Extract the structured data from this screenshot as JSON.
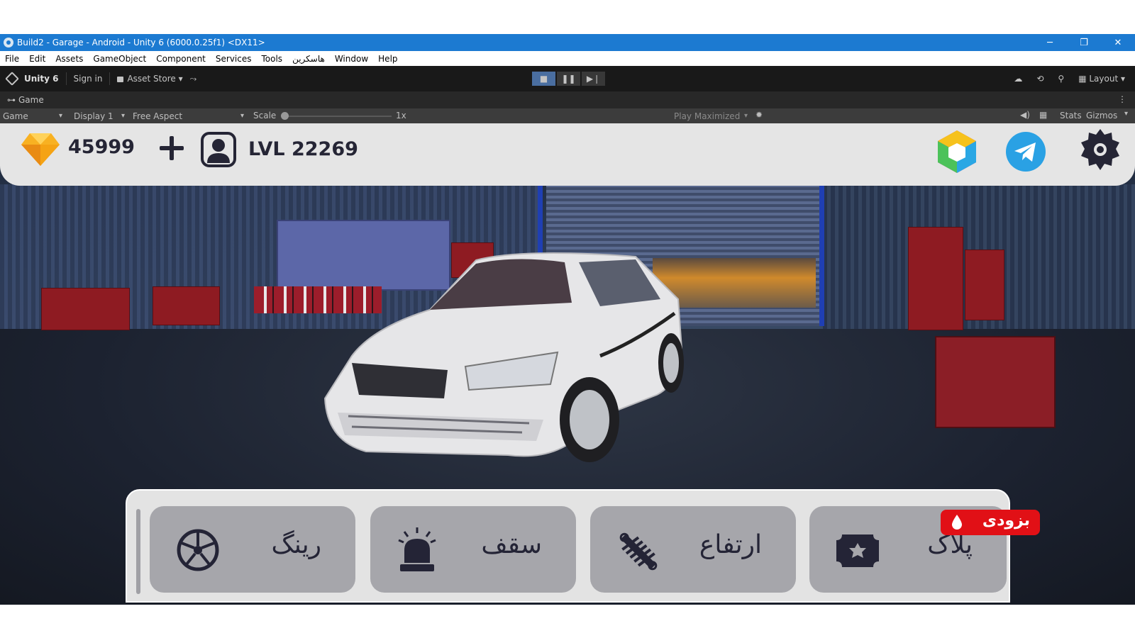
{
  "window": {
    "title": "Build2 - Garage - Android - Unity 6 (6000.0.25f1) <DX11>",
    "controls": [
      "─",
      "❐",
      "✕"
    ]
  },
  "menu": {
    "items": [
      "File",
      "Edit",
      "Assets",
      "GameObject",
      "Component",
      "Services",
      "Tools",
      "هاسکرین",
      "Window",
      "Help"
    ]
  },
  "toolbar": {
    "product": "Unity 6",
    "signin": "Sign in",
    "asset_store": "Asset Store",
    "layout": "Layout",
    "play_buttons": [
      "■",
      "❚❚",
      "▶❘"
    ]
  },
  "game_tab": {
    "label": "Game",
    "kebab": "⋮"
  },
  "game_bar": {
    "mode": "Game",
    "display": "Display 1",
    "aspect": "Free Aspect",
    "scale_label": "Scale",
    "scale_value": "1x",
    "play_maximized": "Play Maximized",
    "stats": "Stats",
    "gizmos": "Gizmos"
  },
  "hud": {
    "gems": "45999",
    "level": "LVL 22269"
  },
  "bottom_menu": {
    "cards": [
      "رینگ",
      "سقف",
      "ارتفاع",
      "پلاک"
    ],
    "soon_badge": "بزودی"
  },
  "colors": {
    "title_bar": "#1c7ad1",
    "play_active": "#4a6ea0",
    "badge_red": "#e11016",
    "telegram_blue": "#2aa1e4",
    "hud_dark": "#252535"
  }
}
